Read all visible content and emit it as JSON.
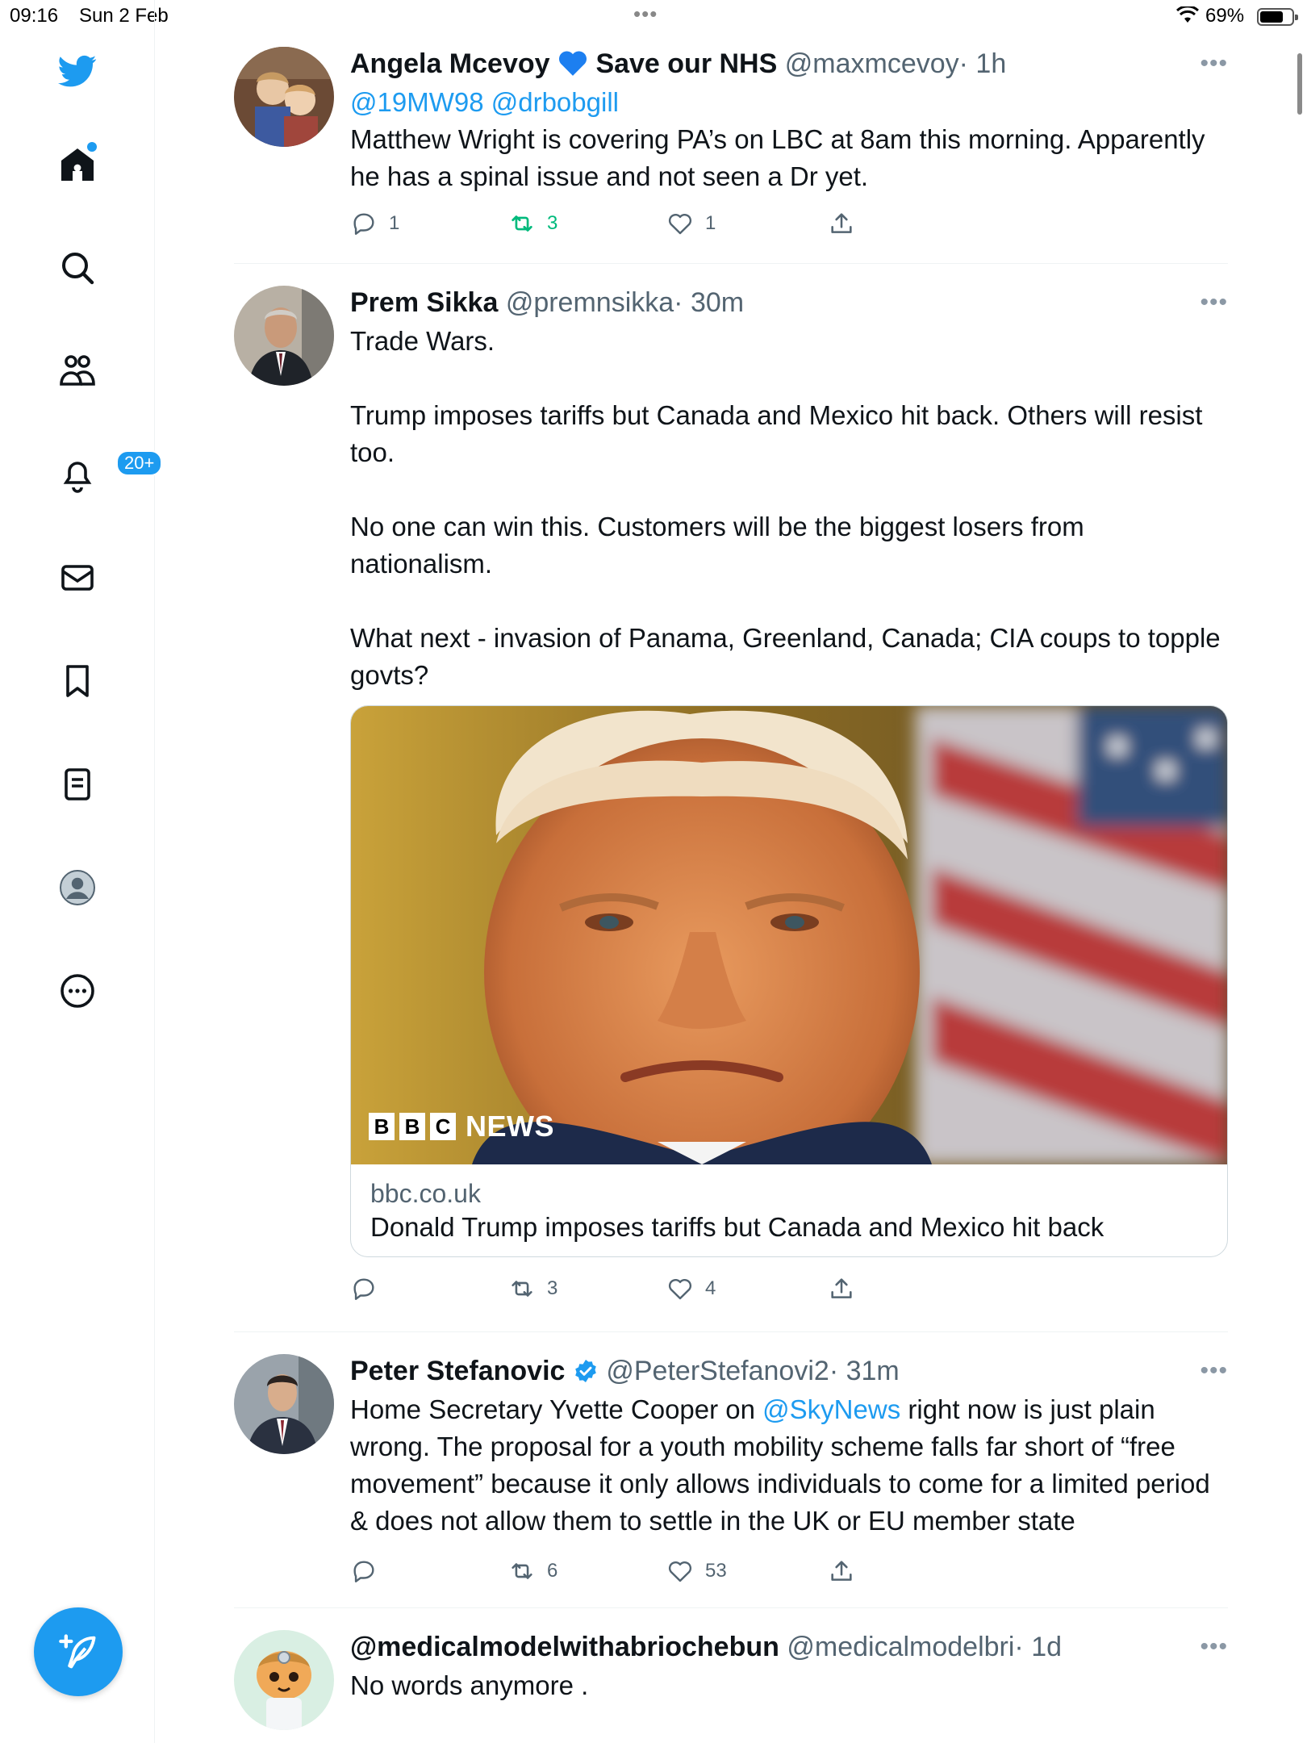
{
  "status_bar": {
    "time": "09:16",
    "date": "Sun 2 Feb",
    "battery": "69%"
  },
  "rail": {
    "notifications_badge": "20+"
  },
  "tweets": [
    {
      "name": "Angela Mcevoy",
      "name_suffix": "Save our NHS",
      "handle": "@maxmcevoy",
      "time": "· 1h",
      "reply_to_1": "@19MW98",
      "reply_to_2": "@drbobgill",
      "text": "Matthew Wright is covering PA’s on LBC at 8am this morning. Apparently he has a spinal issue and not seen a Dr yet.",
      "replies": "1",
      "retweets": "3",
      "likes": "1"
    },
    {
      "name": "Prem Sikka",
      "handle": "@premnsikka",
      "time": "· 30m",
      "paragraphs": [
        "Trade Wars.",
        "Trump imposes tariffs but Canada and Mexico hit back. Others will resist too.",
        "No one can win this. Customers will be the biggest losers from nationalism.",
        "What next - invasion of Panama, Greenland, Canada; CIA coups to topple govts?"
      ],
      "card": {
        "brand_letters": [
          "B",
          "B",
          "C"
        ],
        "brand_word": "NEWS",
        "domain": "bbc.co.uk",
        "title": "Donald Trump imposes tariffs but Canada and Mexico hit back"
      },
      "replies": "",
      "retweets": "3",
      "likes": "4"
    },
    {
      "name": "Peter Stefanovic",
      "handle": "@PeterStefanovi2",
      "time": "· 31m",
      "text_before": "Home Secretary Yvette Cooper on ",
      "text_mention": "@SkyNews",
      "text_after": " right now is just plain wrong. The proposal for a youth mobility scheme falls far short of “free movement” because it only allows individuals to come for a limited period & does not allow them to settle in the UK or EU member state",
      "replies": "",
      "retweets": "6",
      "likes": "53"
    },
    {
      "name": "@medicalmodelwithabriochebun",
      "handle": "@medicalmodelbri",
      "time": "· 1d",
      "text": "No words anymore ."
    }
  ],
  "more_glyph": "•••",
  "colors": {
    "accent": "#1d9bf0",
    "retweet_active": "#00ba7c",
    "secondary_text": "#536471"
  }
}
